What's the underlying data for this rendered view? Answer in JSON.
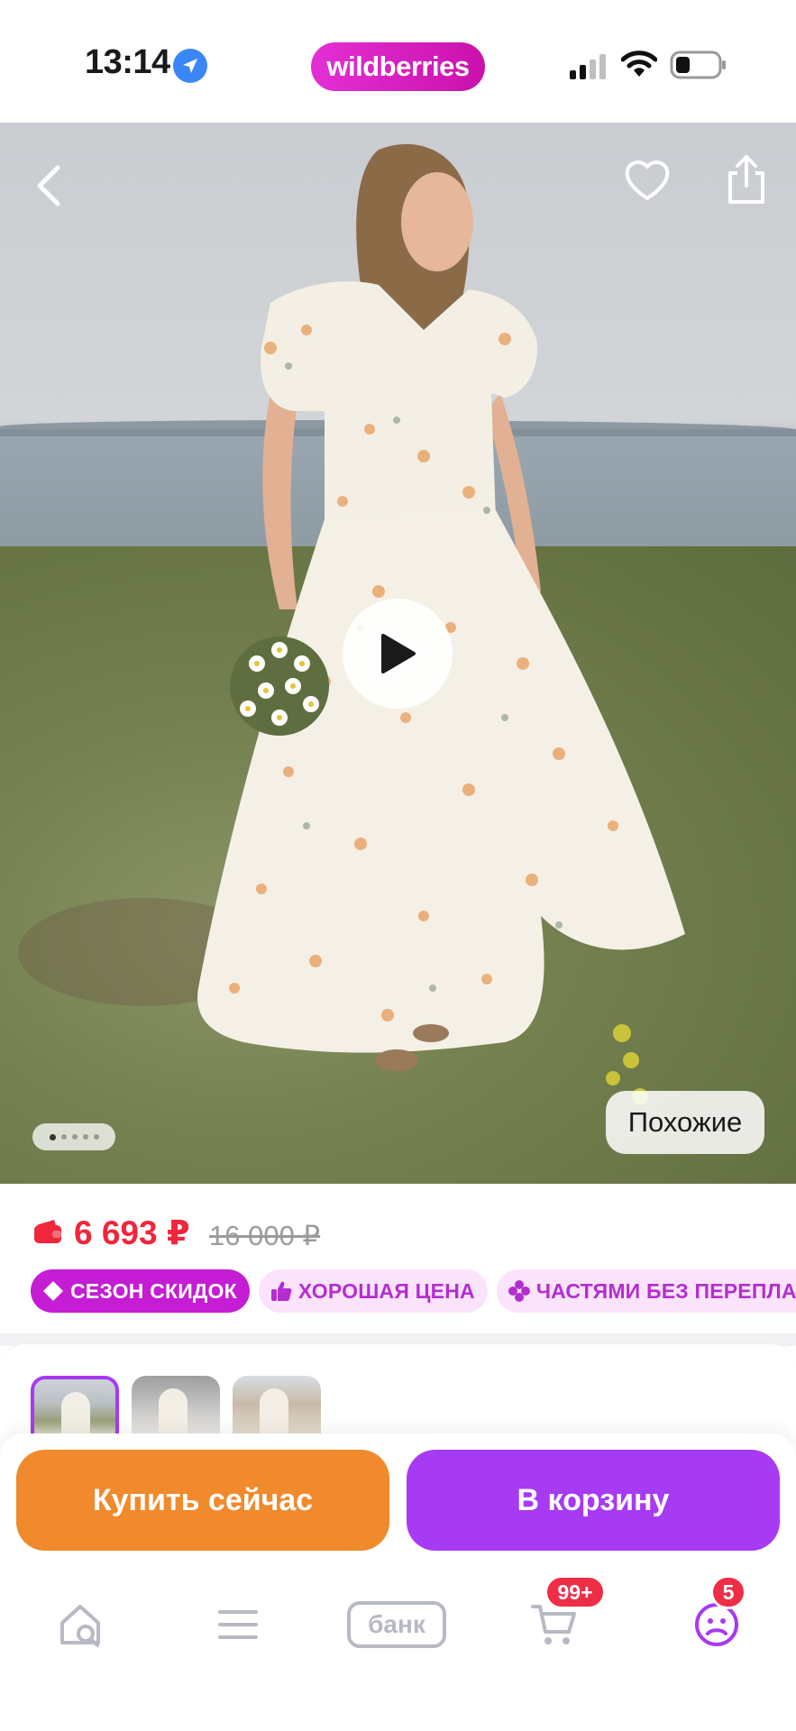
{
  "status_bar": {
    "time": "13:14",
    "brand": "wildberries"
  },
  "product": {
    "similar_label": "Похожие",
    "pager_total": 5,
    "pager_current": 1
  },
  "price": {
    "current": "6 693 ₽",
    "old": "16 000 ₽",
    "badges": [
      {
        "label": "СЕЗОН СКИДОК",
        "icon": "tag-diamond-icon",
        "style": "primary"
      },
      {
        "label": "ХОРОШАЯ ЦЕНА",
        "icon": "thumbs-up-icon",
        "style": "light"
      },
      {
        "label": "ЧАСТЯМИ БЕЗ ПЕРЕПЛАТ",
        "icon": "clover-icon",
        "style": "light"
      }
    ]
  },
  "actions": {
    "buy_now": "Купить сейчас",
    "add_to_cart": "В корзину"
  },
  "tabbar": {
    "bank_label": "банк",
    "cart_badge": "99+",
    "profile_badge": "5"
  },
  "colors": {
    "brand": "#cb11ab",
    "price_red": "#f0263c",
    "buy_orange": "#f08a2c",
    "cart_purple": "#a73af3"
  }
}
